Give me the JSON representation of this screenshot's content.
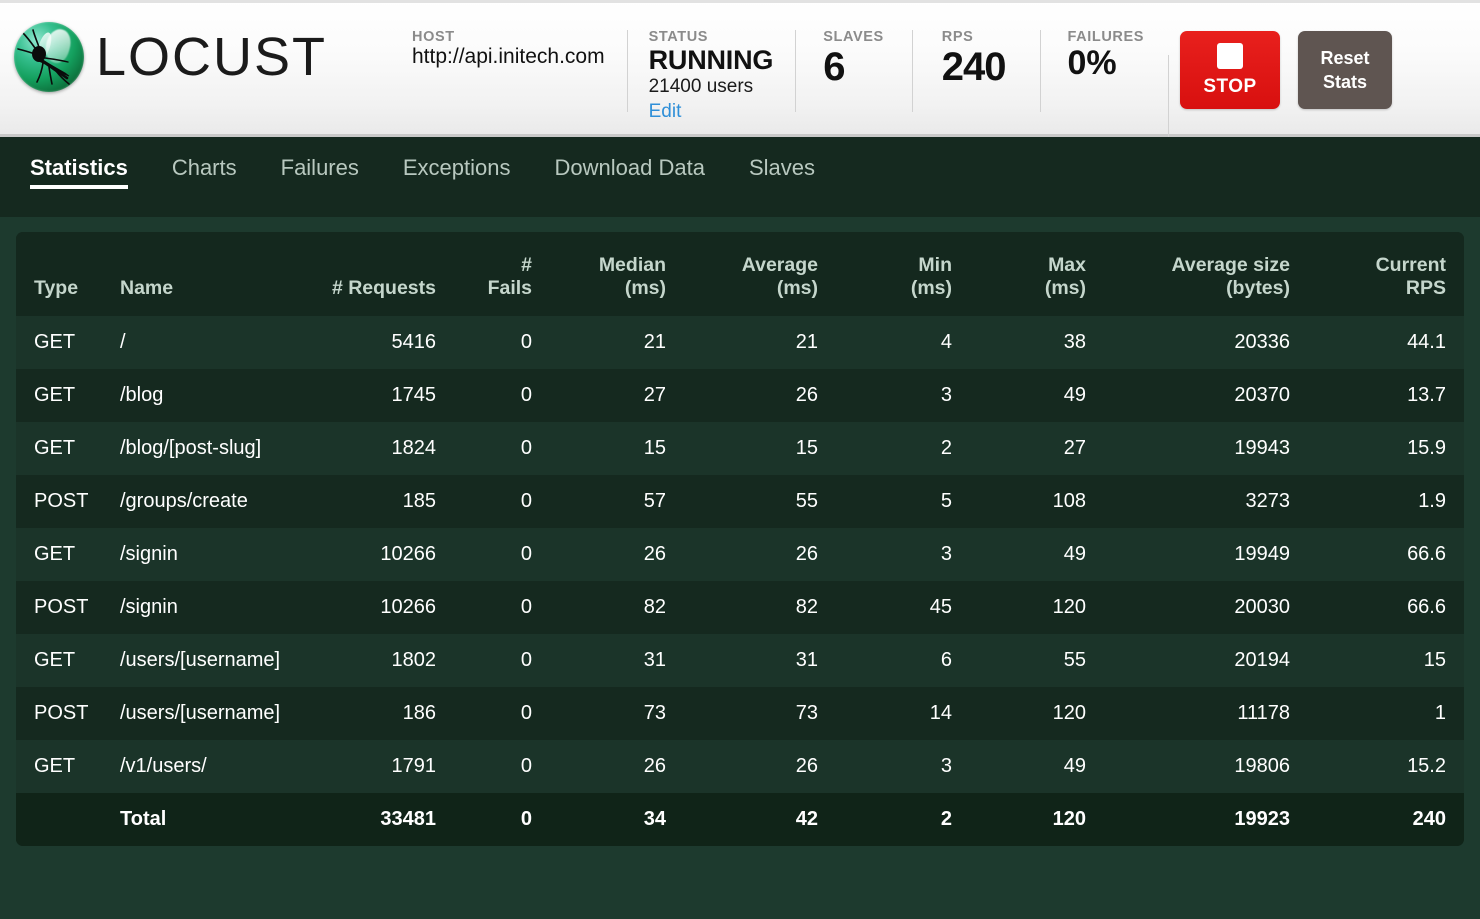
{
  "header": {
    "brand": "LOCUST",
    "logo_icon": "locust-mosquito-icon",
    "host": {
      "label": "HOST",
      "value": "http://api.initech.com"
    },
    "status": {
      "label": "STATUS",
      "value": "RUNNING",
      "users": "21400 users",
      "edit_label": "Edit"
    },
    "slaves": {
      "label": "SLAVES",
      "value": "6"
    },
    "rps": {
      "label": "RPS",
      "value": "240"
    },
    "failures": {
      "label": "FAILURES",
      "value": "0%"
    },
    "stop_button": {
      "label": "STOP",
      "icon": "stop-square-icon",
      "color": "#e01b1b"
    },
    "reset_button": {
      "line1": "Reset",
      "line2": "Stats",
      "color": "#5f5551"
    }
  },
  "nav": {
    "tabs": [
      {
        "label": "Statistics",
        "active": true
      },
      {
        "label": "Charts",
        "active": false
      },
      {
        "label": "Failures",
        "active": false
      },
      {
        "label": "Exceptions",
        "active": false
      },
      {
        "label": "Download Data",
        "active": false
      },
      {
        "label": "Slaves",
        "active": false
      }
    ]
  },
  "table": {
    "columns": [
      {
        "label": "Type",
        "align": "left"
      },
      {
        "label": "Name",
        "align": "left"
      },
      {
        "label": "# Requests",
        "align": "right"
      },
      {
        "label": "# Fails",
        "align": "right"
      },
      {
        "label": "Median\n(ms)",
        "line1": "Median",
        "line2": "(ms)",
        "align": "right"
      },
      {
        "label": "Average\n(ms)",
        "line1": "Average",
        "line2": "(ms)",
        "align": "right"
      },
      {
        "label": "Min\n(ms)",
        "line1": "Min",
        "line2": "(ms)",
        "align": "right"
      },
      {
        "label": "Max\n(ms)",
        "line1": "Max",
        "line2": "(ms)",
        "align": "right"
      },
      {
        "label": "Average size\n(bytes)",
        "line1": "Average size",
        "line2": "(bytes)",
        "align": "right"
      },
      {
        "label": "Current\nRPS",
        "line1": "Current",
        "line2": "RPS",
        "align": "right"
      }
    ],
    "rows": [
      {
        "type": "GET",
        "name": "/",
        "requests": "5416",
        "fails": "0",
        "median": "21",
        "average": "21",
        "min": "4",
        "max": "38",
        "avg_size": "20336",
        "current_rps": "44.1"
      },
      {
        "type": "GET",
        "name": "/blog",
        "requests": "1745",
        "fails": "0",
        "median": "27",
        "average": "26",
        "min": "3",
        "max": "49",
        "avg_size": "20370",
        "current_rps": "13.7"
      },
      {
        "type": "GET",
        "name": "/blog/[post-slug]",
        "requests": "1824",
        "fails": "0",
        "median": "15",
        "average": "15",
        "min": "2",
        "max": "27",
        "avg_size": "19943",
        "current_rps": "15.9"
      },
      {
        "type": "POST",
        "name": "/groups/create",
        "requests": "185",
        "fails": "0",
        "median": "57",
        "average": "55",
        "min": "5",
        "max": "108",
        "avg_size": "3273",
        "current_rps": "1.9"
      },
      {
        "type": "GET",
        "name": "/signin",
        "requests": "10266",
        "fails": "0",
        "median": "26",
        "average": "26",
        "min": "3",
        "max": "49",
        "avg_size": "19949",
        "current_rps": "66.6"
      },
      {
        "type": "POST",
        "name": "/signin",
        "requests": "10266",
        "fails": "0",
        "median": "82",
        "average": "82",
        "min": "45",
        "max": "120",
        "avg_size": "20030",
        "current_rps": "66.6"
      },
      {
        "type": "GET",
        "name": "/users/[username]",
        "requests": "1802",
        "fails": "0",
        "median": "31",
        "average": "31",
        "min": "6",
        "max": "55",
        "avg_size": "20194",
        "current_rps": "15"
      },
      {
        "type": "POST",
        "name": "/users/[username]",
        "requests": "186",
        "fails": "0",
        "median": "73",
        "average": "73",
        "min": "14",
        "max": "120",
        "avg_size": "11178",
        "current_rps": "1"
      },
      {
        "type": "GET",
        "name": "/v1/users/",
        "requests": "1791",
        "fails": "0",
        "median": "26",
        "average": "26",
        "min": "3",
        "max": "49",
        "avg_size": "19806",
        "current_rps": "15.2"
      }
    ],
    "total": {
      "type": "",
      "name": "Total",
      "requests": "33481",
      "fails": "0",
      "median": "34",
      "average": "42",
      "min": "2",
      "max": "120",
      "avg_size": "19923",
      "current_rps": "240"
    }
  }
}
